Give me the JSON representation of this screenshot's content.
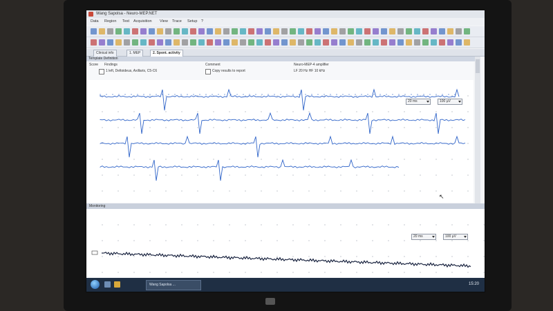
{
  "window": {
    "title": "Wang Sapolsa - Neuro-MEP.NET"
  },
  "menu": [
    "Data",
    "Region",
    "Test",
    "Acquisition",
    "View",
    "Trace",
    "Setup",
    "?"
  ],
  "tabs": [
    {
      "label": "Clinical info",
      "active": false
    },
    {
      "label": "1. MEP",
      "active": false
    },
    {
      "label": "2. Spont. activity",
      "active": true
    }
  ],
  "protocol": {
    "header": "Template Definition",
    "col_score": "Score",
    "col_findings": "Findings",
    "row_value": "1 left, Deltoideus, Axillaris, C5-C6",
    "comment_label": "Comment",
    "copy_label": "Copy results to report",
    "amplifier_label": "Neuro-MEP-4 amplifier",
    "amplifier_settings": "LF 20 Hz  HF 10 kHz"
  },
  "upper_controls": {
    "sweep": "20 ms",
    "sensitivity": "100 µV"
  },
  "monitoring": {
    "header": "Monitoring",
    "sweep": "20 ms",
    "sensitivity": "100 µV"
  },
  "taskbar": {
    "app_button": "Wang Sapolsa ...",
    "time": "15:20"
  }
}
